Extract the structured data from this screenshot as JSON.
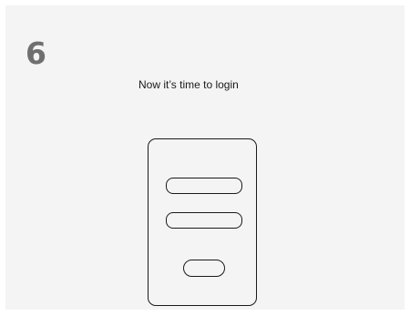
{
  "step": {
    "number": "6",
    "caption": "Now it’s time to login"
  },
  "colors": {
    "panel_background": "#f4f4f4",
    "step_number": "#6f6f6f",
    "outline": "#1a1a1a"
  }
}
